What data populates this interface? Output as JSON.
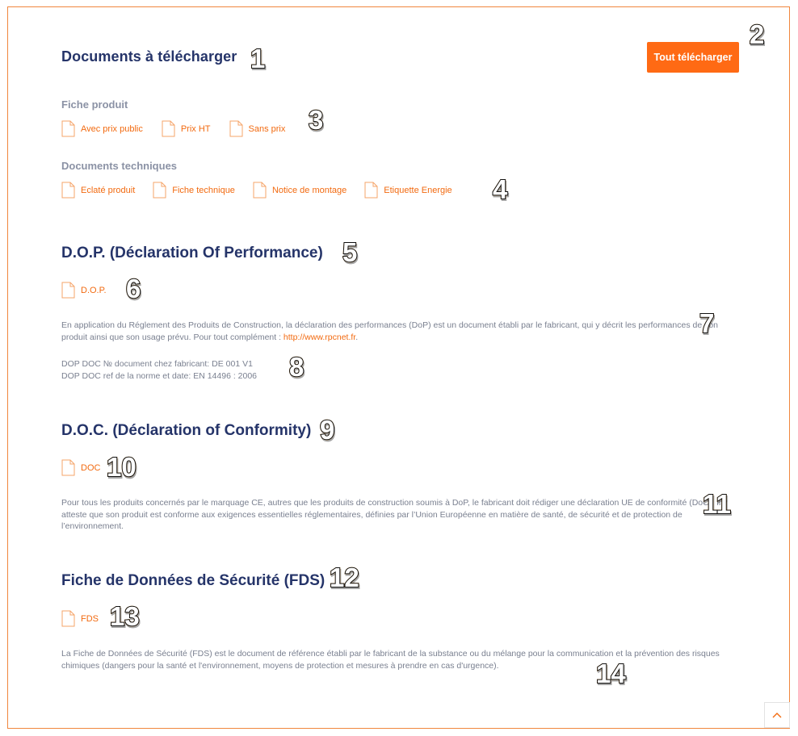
{
  "downloads": {
    "title": "Documents à télécharger",
    "download_all_label": "Tout télécharger",
    "fiche_produit": {
      "heading": "Fiche produit",
      "links": [
        "Avec prix public",
        "Prix HT",
        "Sans prix"
      ]
    },
    "docs_techniques": {
      "heading": "Documents techniques",
      "links": [
        "Eclaté produit",
        "Fiche technique",
        "Notice de montage",
        "Etiquette Energie"
      ]
    }
  },
  "dop": {
    "title": "D.O.P. (Déclaration Of Performance)",
    "link": "D.O.P.",
    "paragraph_text": "En application du Réglement des Produits de Construction, la déclaration des performances (DoP) est un document établi par le fabricant, qui y décrit les performances de son produit ainsi que son usage prévu. Pour tout complément : ",
    "paragraph_link": "http://www.rpcnet.fr",
    "paragraph_end": ".",
    "doc_number": "DOP DOC № document chez fabricant: DE 001 V1",
    "doc_ref": "DOP DOC ref de la norme et date: EN 14496 : 2006"
  },
  "doc": {
    "title": "D.O.C. (Déclaration of Conformity)",
    "link": "DOC",
    "paragraph": "Pour tous les produits concernés par le marquage CE, autres que les produits de construction soumis à DoP, le fabricant doit rédiger une déclaration UE de conformité (DoC). Il y atteste que son produit est conforme aux exigences essentielles réglementaires, définies par l’Union Européenne en matière de santé, de sécurité et de protection de l’environnement."
  },
  "fds": {
    "title": "Fiche de Données de Sécurité (FDS)",
    "link": "FDS",
    "paragraph": "La Fiche de Données de Sécurité (FDS) est le document de référence établi par le fabricant de la substance ou du mélange pour la communication et la prévention des risques chimiques (dangers pour la santé et l'environnement, moyens de protection et mesures à prendre en cas d'urgence)."
  },
  "annotations": [
    "1",
    "2",
    "3",
    "4",
    "5",
    "6",
    "7",
    "8",
    "9",
    "10",
    "11",
    "12",
    "13",
    "14"
  ],
  "colors": {
    "accent": "#ff6a14",
    "heading": "#253469",
    "muted": "#8b92a5",
    "border": "#f0873e"
  },
  "icons": {
    "document": "document-icon",
    "scroll_top": "chevron-up-icon"
  }
}
